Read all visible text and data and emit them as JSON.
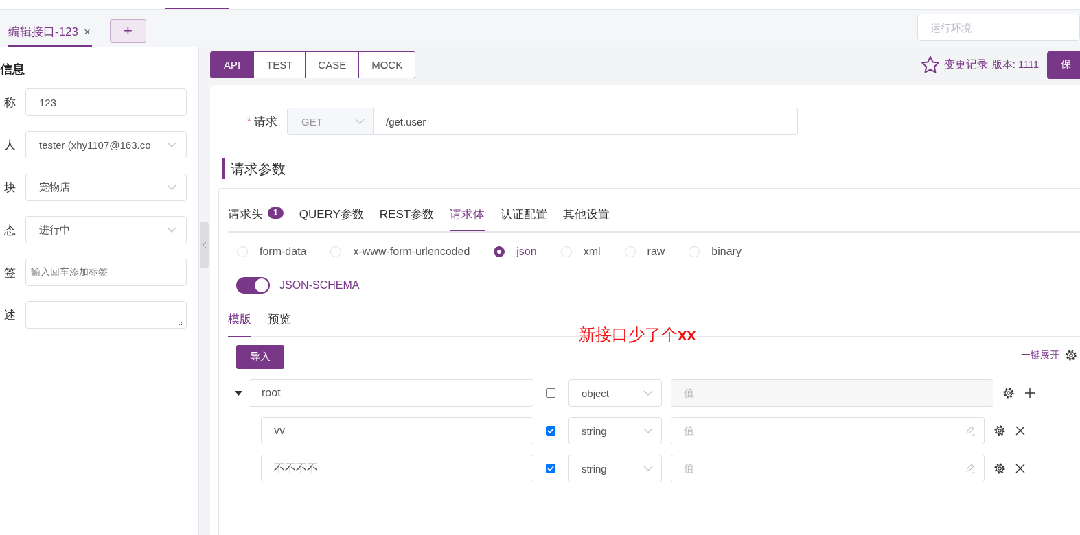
{
  "tabs": [
    {
      "label": "编辑接口-123",
      "close": "×",
      "selected": true
    }
  ],
  "add_tab": "+",
  "env_field": {
    "placeholder": "运行环境"
  },
  "info_panel": {
    "title": "信息",
    "fields": [
      {
        "label": "称",
        "kind": "input",
        "value": "123"
      },
      {
        "label": "人",
        "kind": "select",
        "value": "tester (xhy1107@163.co"
      },
      {
        "label": "块",
        "kind": "select",
        "value": "宠物店"
      },
      {
        "label": "态",
        "kind": "select",
        "value": "进行中"
      },
      {
        "label": "签",
        "kind": "input",
        "placeholder": "输入回车添加标签"
      },
      {
        "label": "述",
        "kind": "textarea"
      }
    ]
  },
  "mode_tabs": [
    {
      "label": "API",
      "selected": true
    },
    {
      "label": "TEST",
      "selected": false
    },
    {
      "label": "CASE",
      "selected": false
    },
    {
      "label": "MOCK",
      "selected": false
    }
  ],
  "header_actions": {
    "history": "变更记录",
    "version": "版本: 1111",
    "save": "保"
  },
  "request": {
    "label": "请求",
    "required_mark": "*",
    "method": "GET",
    "url": "/get.user"
  },
  "section_title": "请求参数",
  "param_tabs": [
    {
      "label": "请求头",
      "badge": "1",
      "selected": false
    },
    {
      "label": "QUERY参数",
      "selected": false
    },
    {
      "label": "REST参数",
      "selected": false
    },
    {
      "label": "请求体",
      "selected": true
    },
    {
      "label": "认证配置",
      "selected": false
    },
    {
      "label": "其他设置",
      "selected": false
    }
  ],
  "body_types": [
    {
      "label": "form-data",
      "selected": false
    },
    {
      "label": "x-www-form-urlencoded",
      "selected": false
    },
    {
      "label": "json",
      "selected": true
    },
    {
      "label": "xml",
      "selected": false
    },
    {
      "label": "raw",
      "selected": false
    },
    {
      "label": "binary",
      "selected": false
    }
  ],
  "json_schema": {
    "label": "JSON-SCHEMA",
    "on": true
  },
  "editor_tabs": [
    {
      "label": "模版",
      "selected": true
    },
    {
      "label": "预览",
      "selected": false
    }
  ],
  "annotation": "新接口少了个**xx**",
  "import_button": "导入",
  "expand_all": "一键展开",
  "schema": {
    "name": "root",
    "expanded": true,
    "required": false,
    "type": "object",
    "placeholder": "值",
    "value_disabled": true,
    "children": [
      {
        "name": "vv",
        "required": true,
        "type": "string",
        "placeholder": "值",
        "value_disabled": false
      },
      {
        "name": "不不不不",
        "required": true,
        "type": "string",
        "placeholder": "值",
        "value_disabled": false
      }
    ]
  }
}
